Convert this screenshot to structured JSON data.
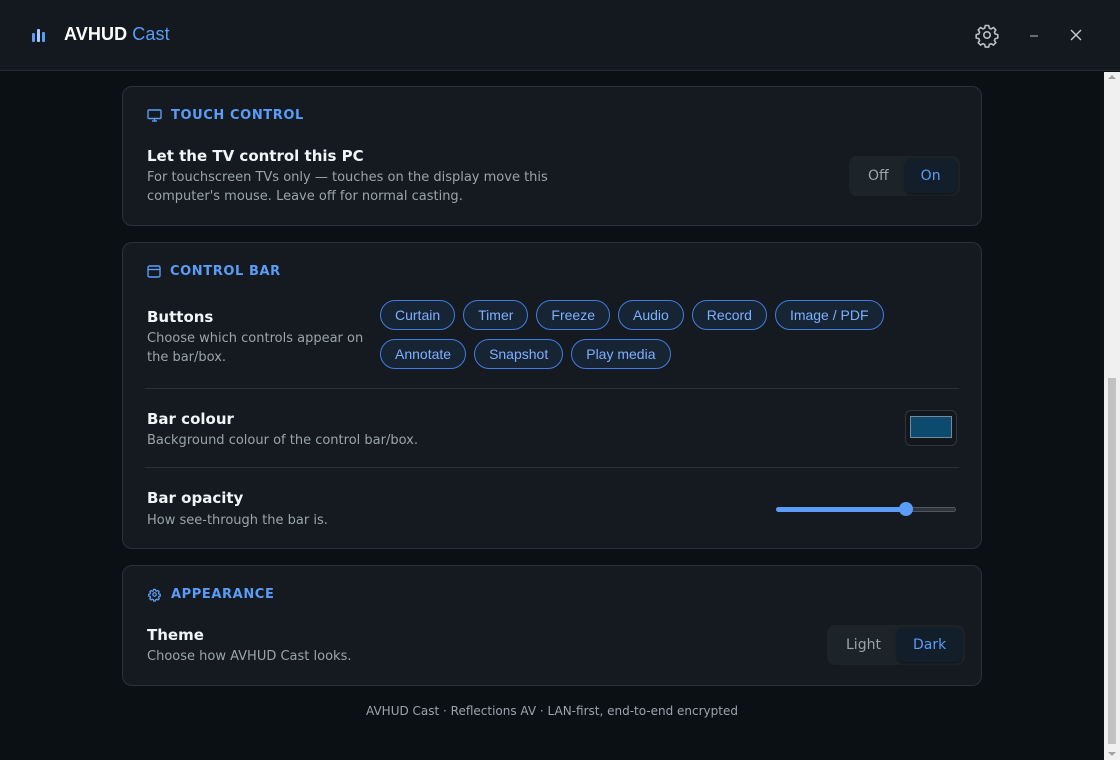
{
  "window": {
    "title_main": "AVHUD",
    "title_accent": "Cast",
    "settings_icon": "gear-icon",
    "minimize_icon": "minimize-icon",
    "close_icon": "close-icon"
  },
  "touch_control": {
    "heading": "TOUCH CONTROL",
    "icon": "monitor-icon",
    "title": "Let the TV control this PC",
    "description_line1": "For touchscreen TVs only — touches on the display move this",
    "description_line2": "computer's mouse. Leave off for normal casting.",
    "options": [
      "Off",
      "On"
    ],
    "selected": "On"
  },
  "control_bar": {
    "heading": "CONTROL BAR",
    "icon": "window-icon",
    "buttons": {
      "title": "Buttons",
      "description_line1": "Choose which controls appear on",
      "description_line2": "the bar/box.",
      "chips": [
        "Curtain",
        "Timer",
        "Freeze",
        "Audio",
        "Record",
        "Image / PDF",
        "Annotate",
        "Snapshot",
        "Play media"
      ]
    },
    "colour": {
      "title": "Bar colour",
      "description": "Background colour of the control bar/box.",
      "value": "#0c4a6e"
    },
    "opacity": {
      "title": "Bar opacity",
      "description": "How see-through the bar is.",
      "value": 0.72
    }
  },
  "appearance": {
    "heading": "APPEARANCE",
    "icon": "gear-icon",
    "title": "Theme",
    "description": "Choose how AVHUD Cast looks.",
    "options": [
      "Light",
      "Dark"
    ],
    "selected": "Dark"
  },
  "footer": {
    "text": "AVHUD Cast · Reflections AV · LAN-first, end-to-end encrypted"
  },
  "colors": {
    "accent": "#5b9cf6",
    "background": "#0b1014",
    "card": "#141a1f"
  }
}
